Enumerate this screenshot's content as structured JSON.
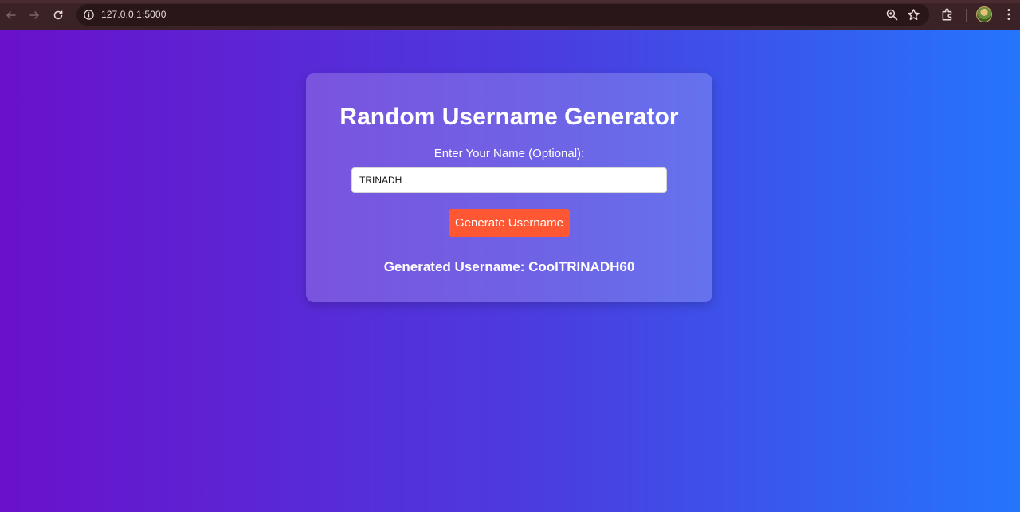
{
  "browser": {
    "url": "127.0.0.1:5000"
  },
  "app": {
    "title": "Random Username Generator",
    "name_label": "Enter Your Name (Optional):",
    "name_value": "TRINADH",
    "generate_button": "Generate Username",
    "result_prefix": "Generated Username: ",
    "result_value": "CoolTRINADH60"
  },
  "colors": {
    "gradient_start": "#6a11cb",
    "gradient_end": "#2575fc",
    "button": "#ff5733"
  }
}
